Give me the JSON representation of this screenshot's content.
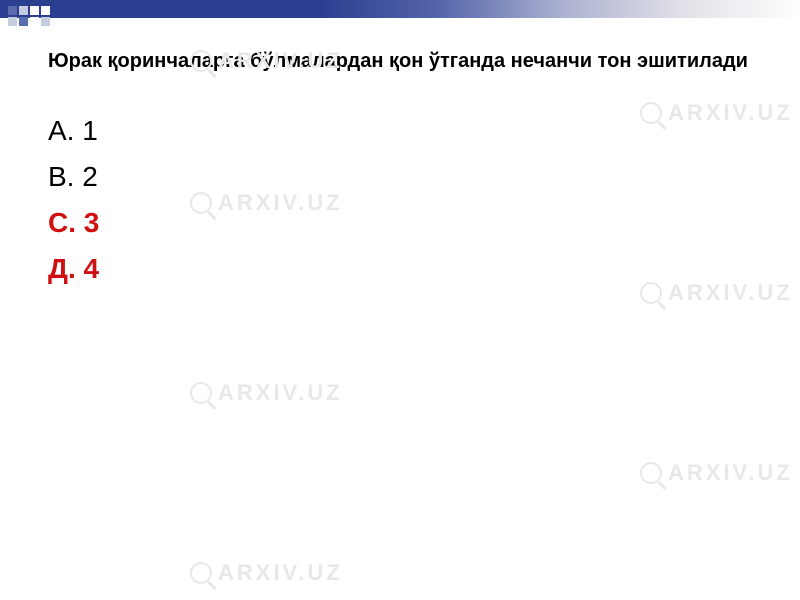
{
  "question": "Юрак қоринчаларга бўлмалардан қон ўтганда нечанчи тон эшитилади",
  "options": [
    {
      "label": "А. 1",
      "highlight": false
    },
    {
      "label": "В. 2",
      "highlight": false
    },
    {
      "label": "С. 3",
      "highlight": true
    },
    {
      "label": "Д. 4",
      "highlight": true
    }
  ],
  "watermark_text": "ARXIV.UZ"
}
